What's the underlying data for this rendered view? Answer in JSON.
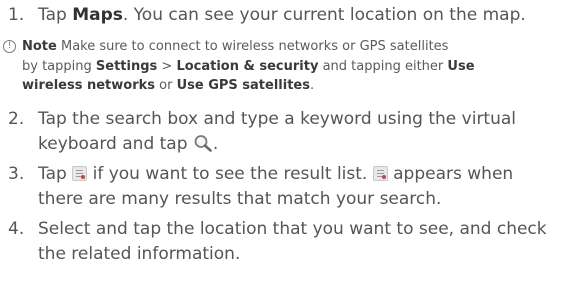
{
  "steps": [
    {
      "number": "1.",
      "line1_prefix": "Tap ",
      "line1_bold": "Maps",
      "line1_suffix": ". You can see your current location on the map."
    },
    {
      "number": "2.",
      "line1": "Tap the search box and type a keyword using the virtual",
      "line2_prefix": "keyboard and tap ",
      "line2_icon": "magnifier-icon",
      "line2_suffix": "."
    },
    {
      "number": "3.",
      "line1_prefix": "Tap ",
      "line1_icon": "result-list-icon",
      "line1_suffix": " if you want to see the result list. ",
      "line1_icon2": "result-list-icon",
      "line1_suffix2": " appears when",
      "line2": "there are many results that match your search."
    },
    {
      "number": "4.",
      "line1": "Select and tap the location that you want to see, and check",
      "line2": "the related information."
    }
  ],
  "note": {
    "icon": "note-icon",
    "icon_glyph": "!",
    "label": "Note",
    "line1_text": " Make sure to connect to wireless networks or GPS satellites",
    "line2_prefix": "by tapping ",
    "line2_bold1": "Settings",
    "line2_sep": " > ",
    "line2_bold2": "Location & security",
    "line2_mid": " and tapping either ",
    "line2_bold3": "Use",
    "line3_bold1": "wireless networks",
    "line3_mid": " or ",
    "line3_bold2": "Use GPS satellites",
    "line3_suffix": "."
  }
}
